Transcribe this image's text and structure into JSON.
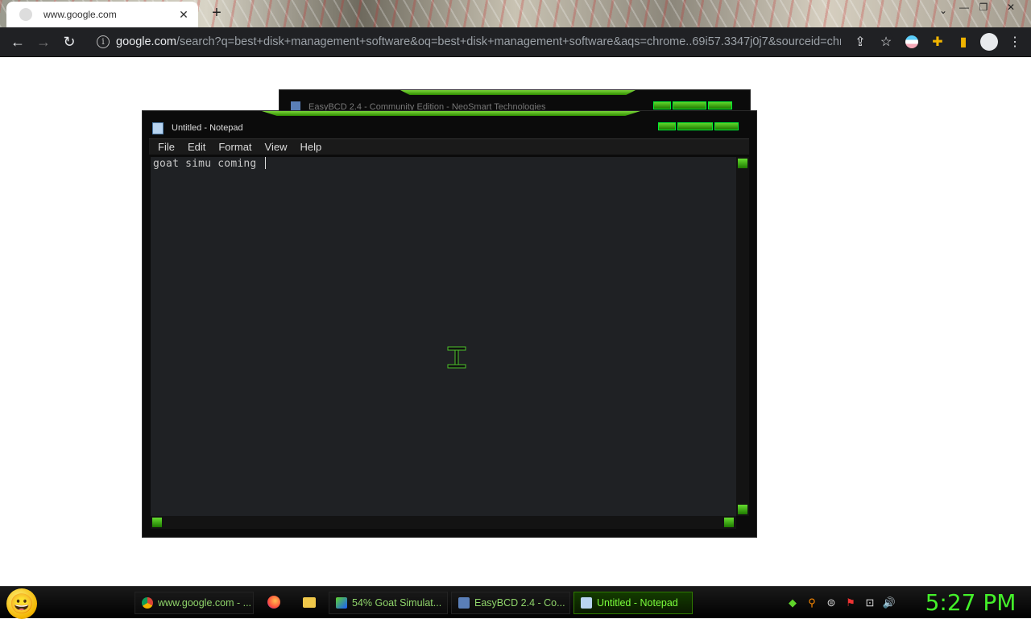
{
  "browser": {
    "tab_title": "www.google.com",
    "url_host": "google.com",
    "url_rest": "/search?q=best+disk+management+software&oq=best+disk+management+software&aqs=chrome..69i57.3347j0j7&sourceid=chr..."
  },
  "bg_window": {
    "title": "EasyBCD 2.4 - Community Edition - NeoSmart Technologies"
  },
  "notepad": {
    "title": "Untitled - Notepad",
    "menu": [
      "File",
      "Edit",
      "Format",
      "View",
      "Help"
    ],
    "content": "goat simu coming "
  },
  "taskbar": {
    "tasks": [
      {
        "label": "www.google.com - ...",
        "icon": "chrome-icon",
        "active": false
      },
      {
        "label": "54% Goat Simulat...",
        "icon": "download-icon",
        "active": false
      },
      {
        "label": "EasyBCD 2.4 - Co...",
        "icon": "easybcd-icon",
        "active": false
      },
      {
        "label": "Untitled - Notepad",
        "icon": "notepad-icon",
        "active": true
      }
    ],
    "clock": "5:27 PM"
  },
  "colors": {
    "accent_green": "#44f02a",
    "chrome_dark": "#202124"
  }
}
